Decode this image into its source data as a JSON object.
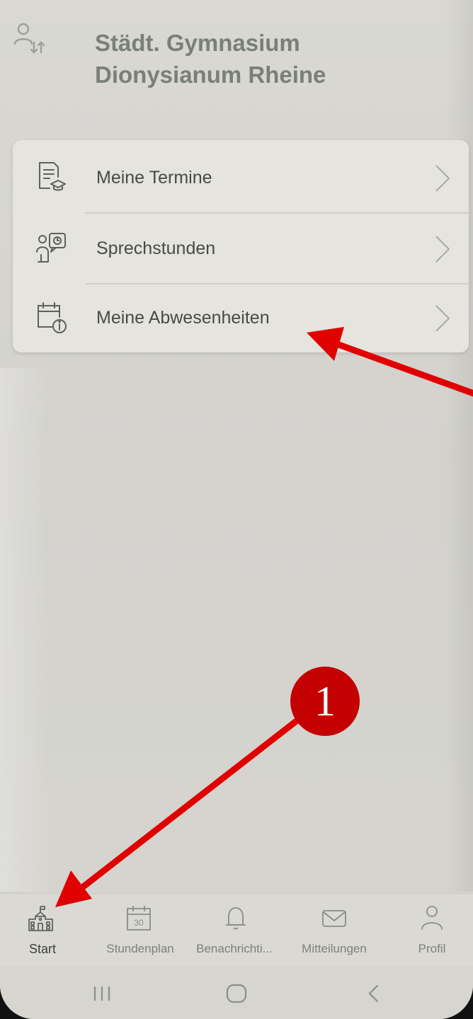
{
  "header": {
    "school_name_line1": "Städt. Gymnasium",
    "school_name_line2": "Dionysianum Rheine",
    "switch_icon": "user-switch-icon"
  },
  "menu": {
    "items": [
      {
        "label": "Meine Termine",
        "icon": "document-graduation-icon"
      },
      {
        "label": "Sprechstunden",
        "icon": "consultation-icon"
      },
      {
        "label": "Meine Abwesenheiten",
        "icon": "calendar-info-icon"
      }
    ]
  },
  "annotation": {
    "badge_number": "1",
    "color": "#e00000"
  },
  "bottom_nav": {
    "items": [
      {
        "label": "Start",
        "icon": "school-building-icon",
        "active": true
      },
      {
        "label": "Stundenplan",
        "icon": "calendar-30-icon",
        "calendar_day": "30"
      },
      {
        "label": "Benachrichti...",
        "icon": "bell-icon"
      },
      {
        "label": "Mitteilungen",
        "icon": "envelope-icon"
      },
      {
        "label": "Profil",
        "icon": "person-icon"
      }
    ]
  },
  "system_nav": {
    "icons": [
      "recent-apps-icon",
      "home-icon",
      "back-icon"
    ]
  },
  "colors": {
    "header_text": "#7a7f79",
    "menu_text": "#474b47",
    "annotation_red": "#e00000"
  }
}
